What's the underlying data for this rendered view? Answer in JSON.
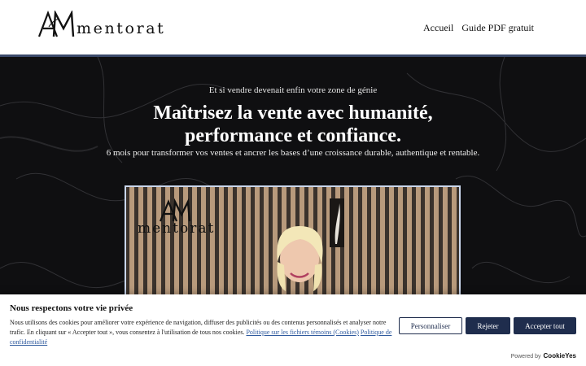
{
  "brand": {
    "name": "mentorat",
    "monogram": "AM",
    "logo_icon": "am-monogram-icon"
  },
  "nav": {
    "items": [
      {
        "label": "Accueil"
      },
      {
        "label": "Guide PDF gratuit"
      }
    ]
  },
  "hero": {
    "kicker": "Et si vendre devenait enfin votre zone de génie",
    "headline_line1": "Maîtrisez la vente avec humanité,",
    "headline_line2": "performance et confiance.",
    "subline": "6 mois pour transformer vos ventes et ancrer les bases d’une croissance durable, authentique et rentable.",
    "video": {
      "overlay_brand": "mentorat",
      "overlay_monogram": "AM"
    }
  },
  "cookie_banner": {
    "title": "Nous respectons votre vie privée",
    "text": "Nous utilisons des cookies pour améliorer votre expérience de navigation, diffuser des publicités ou des contenus personnalisés et analyser notre trafic. En cliquant sur « Accepter tout », vous consentez à l'utilisation de tous nos cookies.",
    "link_cookies": "Politique sur les fichiers témoins (Cookies)",
    "link_privacy": "Politique de confidentialité",
    "customize_label": "Personnaliser",
    "reject_label": "Rejeter",
    "accept_label": "Accepter tout",
    "powered_by": "Powered by",
    "powered_brand": "CookieYes"
  },
  "colors": {
    "accent": "#1f2d4d",
    "header_rule": "#3b4a6b",
    "link": "#2f5a9e",
    "hero_bg": "#0e0e10"
  }
}
